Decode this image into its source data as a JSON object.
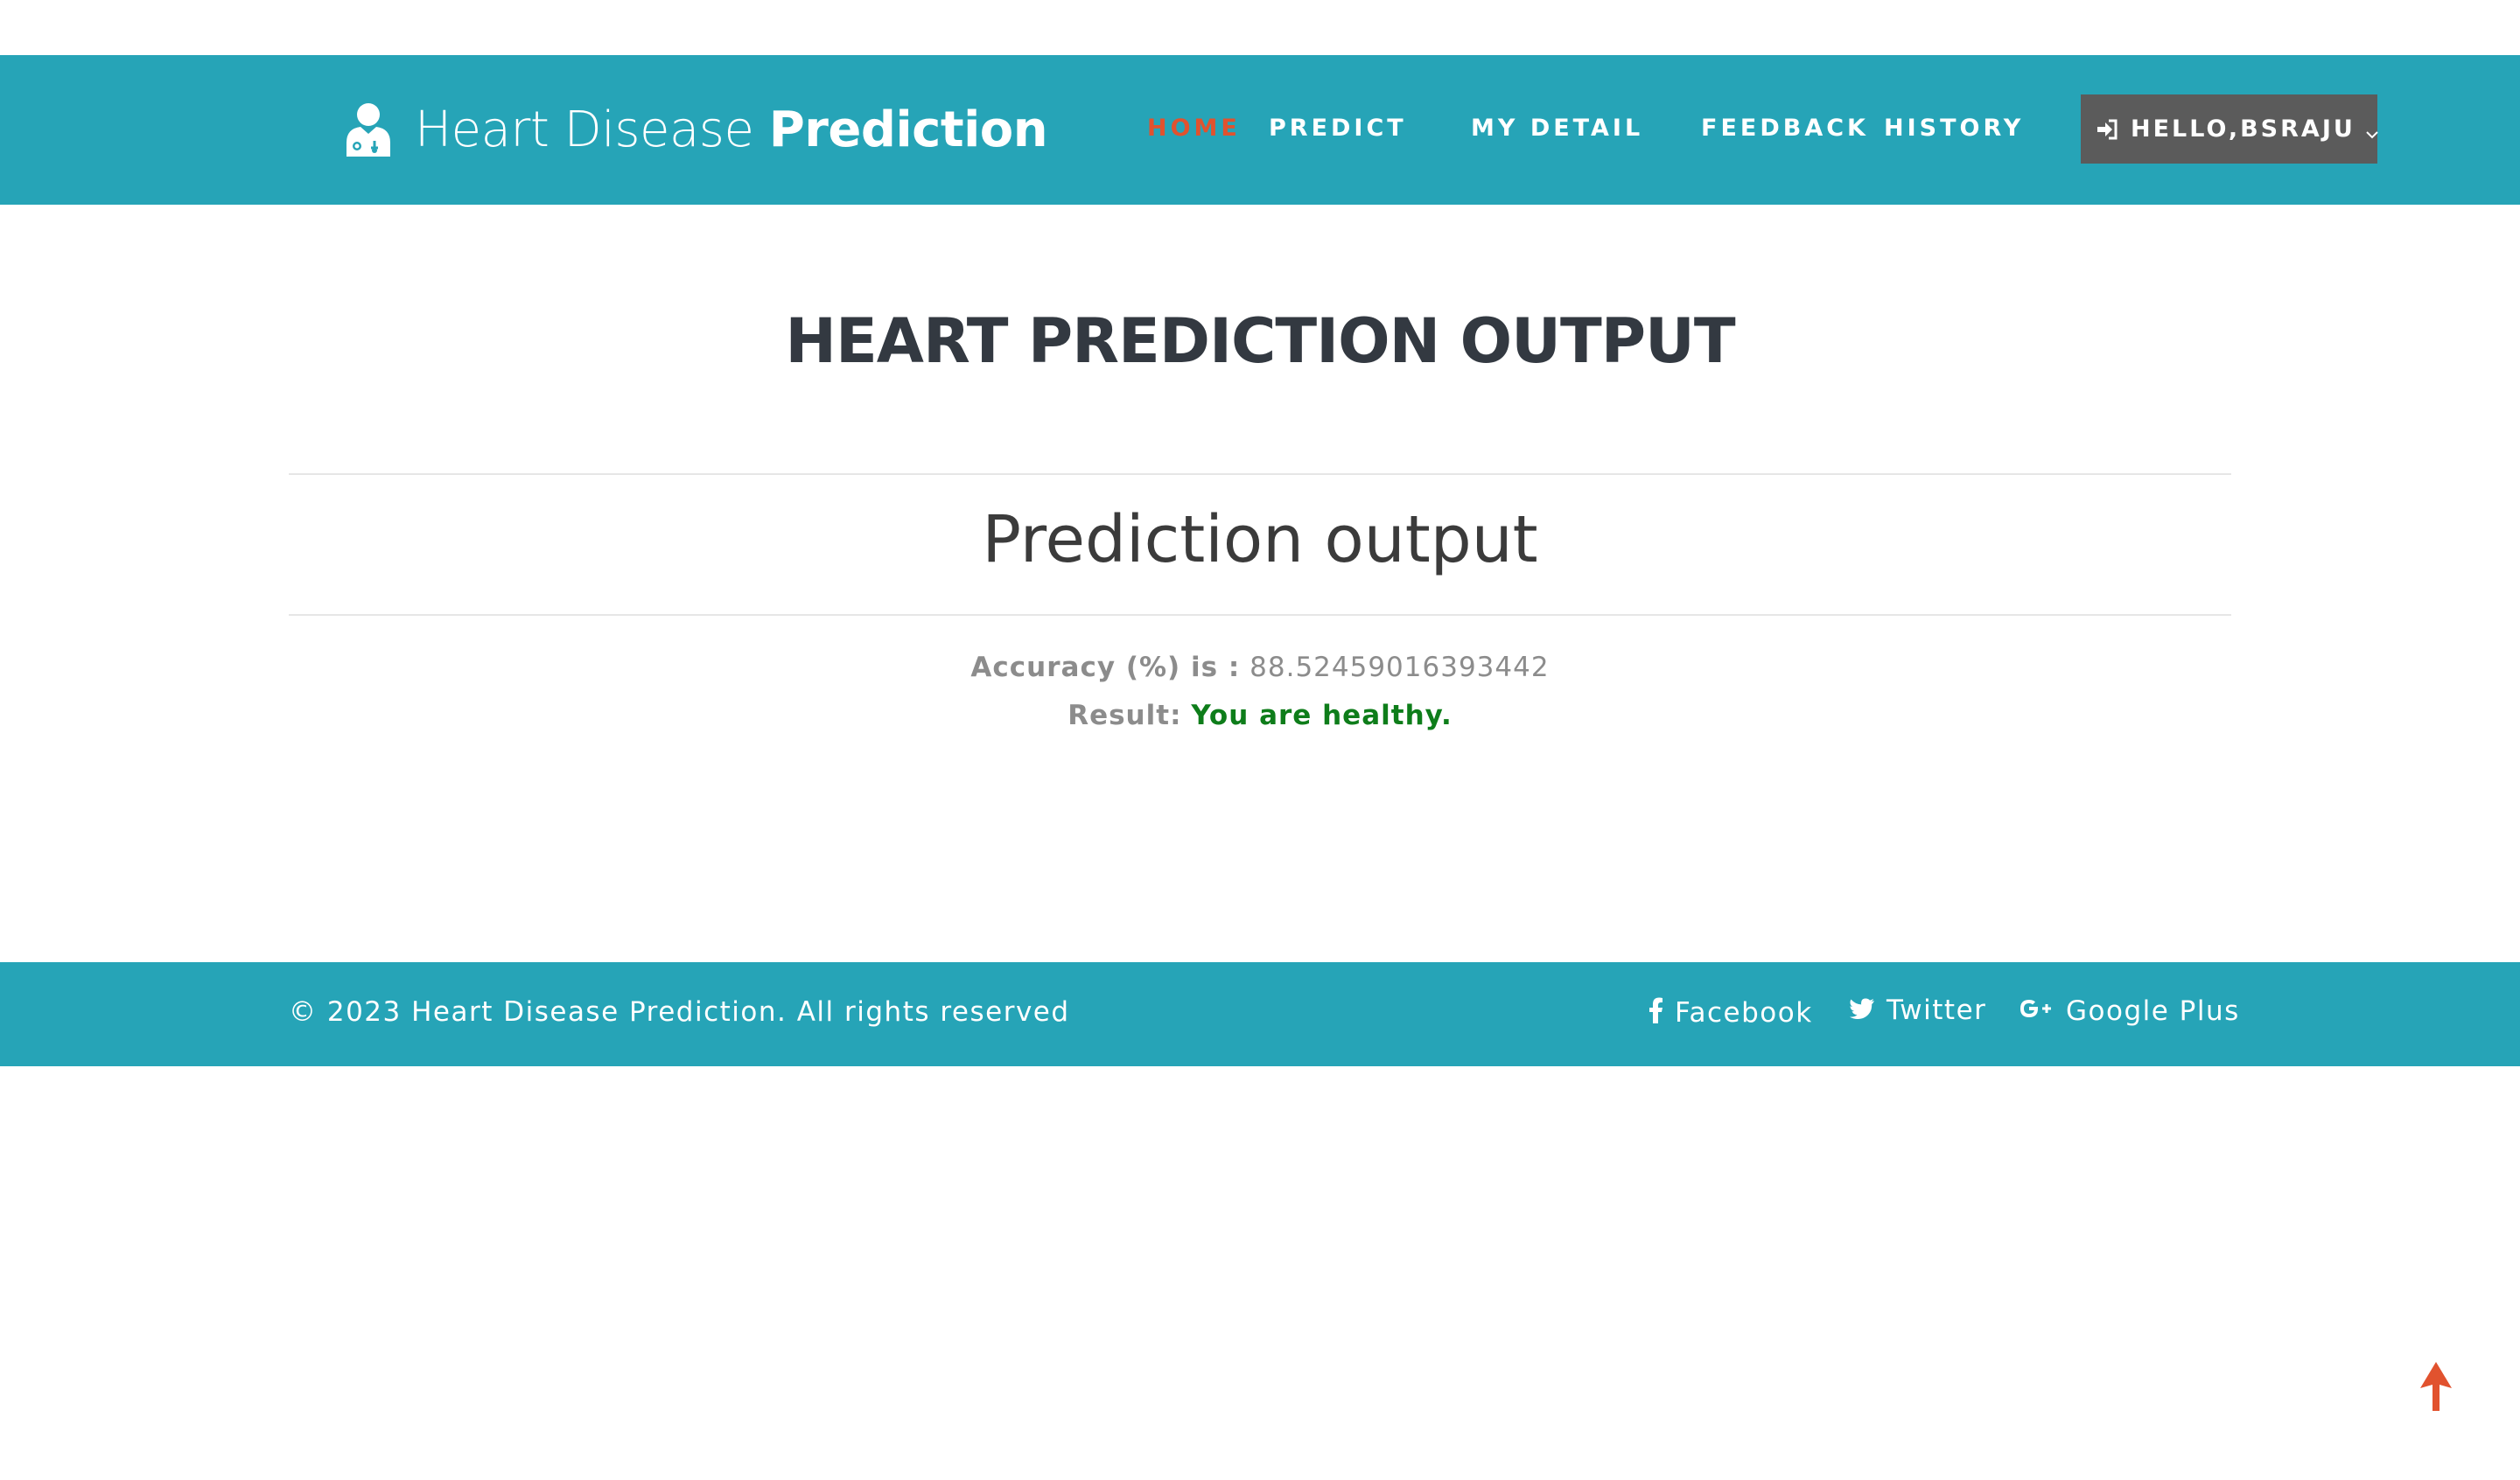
{
  "header": {
    "brand_light": "Heart Disease ",
    "brand_bold": "Prediction",
    "brand_icon": "doctor-icon",
    "nav": {
      "home": "HOME",
      "predict": "PREDICT",
      "my_detail": "MY DETAIL",
      "feedback": "FEEDBACK",
      "history": "HISTORY"
    },
    "user_menu": {
      "label": "HELLO,BSRAJU",
      "icon": "sign-in-icon",
      "caret": "chevron-down-icon"
    }
  },
  "main": {
    "page_title": "HEART PREDICTION OUTPUT",
    "section_title": "Prediction output",
    "accuracy_label": "Accuracy (%) is :",
    "accuracy_value": "88.52459016393442",
    "result_label": "Result:",
    "result_value": "You are healthy."
  },
  "footer": {
    "copyright": "© 2023 Heart Disease Prediction. All rights reserved",
    "social": {
      "facebook": "Facebook",
      "twitter": "Twitter",
      "google_plus": "Google Plus"
    }
  },
  "colors": {
    "header_bg": "#26a4b7",
    "nav_active": "#e1522e",
    "user_button_bg": "#5b5b5b",
    "heading_text": "#333941",
    "muted_text": "#8c8c8c",
    "healthy_green": "#0e7d1a",
    "scroll_top_arrow": "#e1522e"
  },
  "scroll_top": {
    "icon": "arrow-up-icon"
  }
}
